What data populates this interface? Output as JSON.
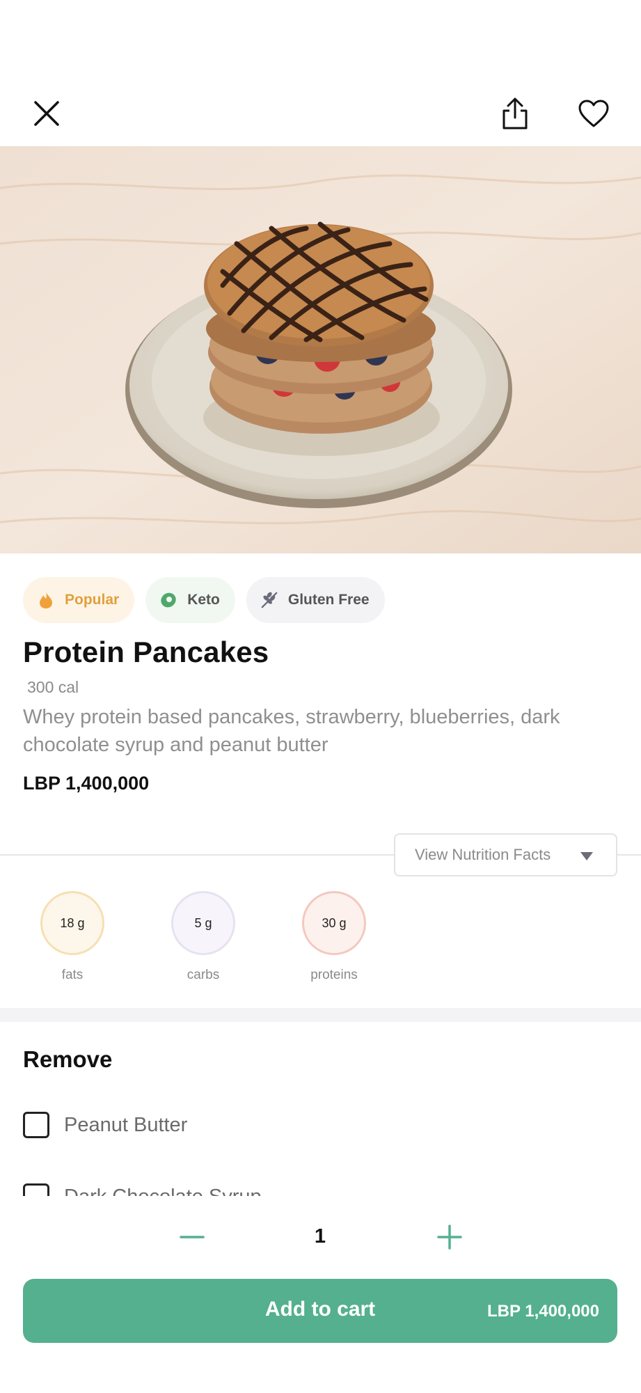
{
  "header": {
    "close_icon": "close-icon",
    "share_icon": "share-icon",
    "favorite_icon": "heart-icon"
  },
  "tags": [
    {
      "label": "Popular",
      "icon": "flame-icon",
      "color": "#e0a03c"
    },
    {
      "label": "Keto",
      "icon": "avocado-icon",
      "color": "#4fa86b"
    },
    {
      "label": "Gluten Free",
      "icon": "wheat-crossed-icon",
      "color": "#6b6b7a"
    }
  ],
  "product": {
    "name": "Protein Pancakes",
    "calories": "300 cal",
    "description": "Whey protein based pancakes, strawberry, blueberries, dark chocolate syrup and peanut butter",
    "price": "LBP 1,400,000"
  },
  "nutrition": {
    "button_label": "View Nutrition Facts",
    "macros": [
      {
        "value": "18 g",
        "label": "fats"
      },
      {
        "value": "5 g",
        "label": "carbs"
      },
      {
        "value": "30 g",
        "label": "proteins"
      }
    ]
  },
  "remove": {
    "title": "Remove",
    "options": [
      {
        "label": "Peanut Butter",
        "checked": false
      },
      {
        "label": "Dark Chocolate Syrup",
        "checked": false
      }
    ]
  },
  "cart": {
    "quantity": "1",
    "add_label": "Add to cart",
    "total": "LBP 1,400,000",
    "accent": "#54b08f"
  }
}
